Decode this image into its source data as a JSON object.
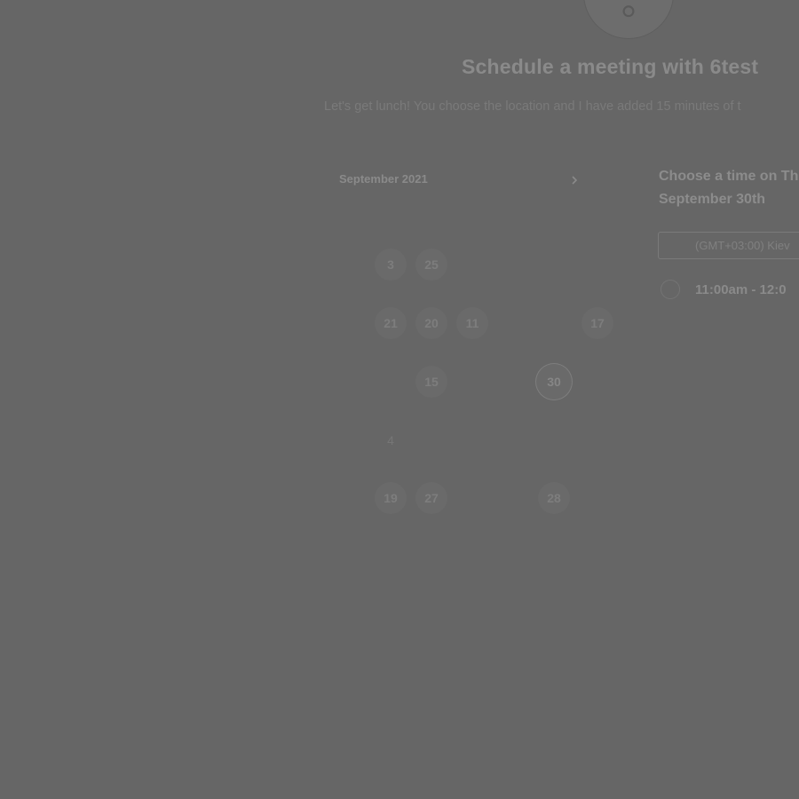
{
  "header": {
    "title": "Schedule a meeting with 6test",
    "subtitle": "Let's get lunch! You choose the location and I have added 15 minutes of t"
  },
  "calendar": {
    "month_label": "September 2021",
    "next_icon": "chevron-right-icon",
    "weekdays": [
      "",
      "",
      "",
      "",
      "",
      "",
      ""
    ],
    "days": [
      {
        "label": "3",
        "row": 0,
        "col": 1,
        "state": "available"
      },
      {
        "label": "25",
        "row": 0,
        "col": 2,
        "state": "available"
      },
      {
        "label": "21",
        "row": 1,
        "col": 1,
        "state": "available"
      },
      {
        "label": "20",
        "row": 1,
        "col": 2,
        "state": "available"
      },
      {
        "label": "11",
        "row": 1,
        "col": 3,
        "state": "available"
      },
      {
        "label": "17",
        "row": 1,
        "col": 6,
        "state": "available"
      },
      {
        "label": "15",
        "row": 2,
        "col": 2,
        "state": "available"
      },
      {
        "label": "30",
        "row": 2,
        "col": 5,
        "state": "selected"
      },
      {
        "label": "4",
        "row": 3,
        "col": 1,
        "state": "plain"
      },
      {
        "label": "19",
        "row": 4,
        "col": 1,
        "state": "available"
      },
      {
        "label": "27",
        "row": 4,
        "col": 2,
        "state": "available"
      },
      {
        "label": "28",
        "row": 4,
        "col": 5,
        "state": "available"
      }
    ]
  },
  "times": {
    "heading": "Choose a time on Th September 30th",
    "timezone": "(GMT+03:00) Kiev",
    "slot_label": "11:00am - 12:0"
  },
  "colors": {
    "overlay": "#666666"
  }
}
